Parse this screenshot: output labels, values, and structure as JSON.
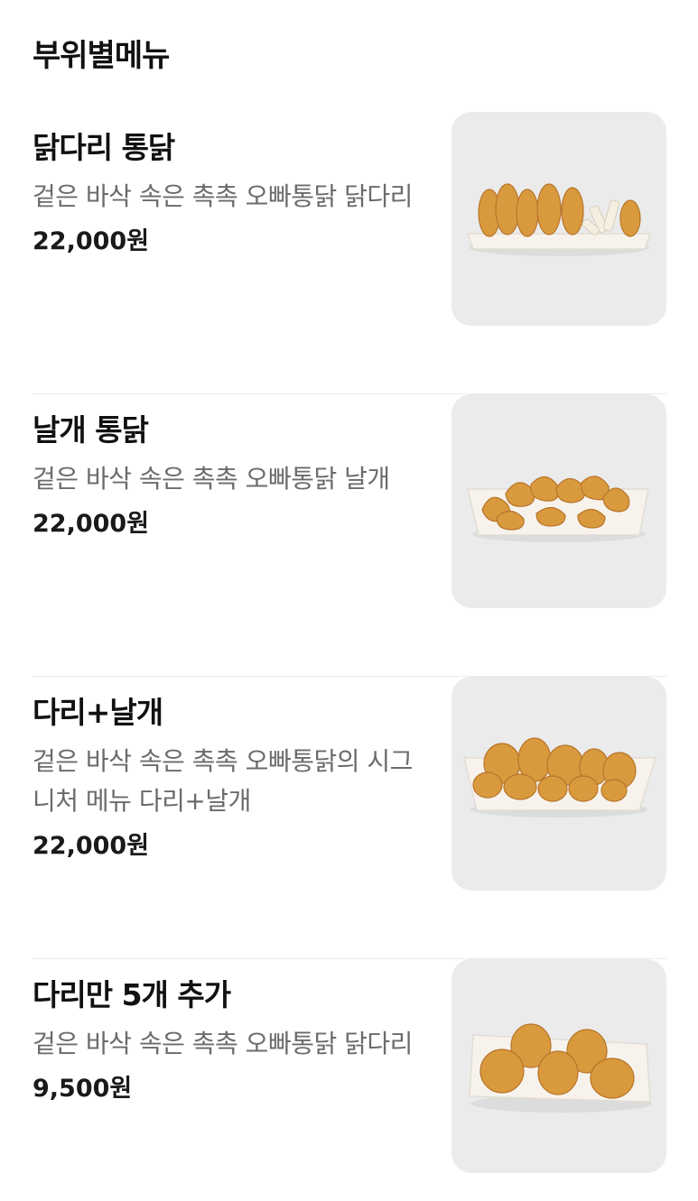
{
  "section": {
    "title": "부위별메뉴"
  },
  "menu": [
    {
      "name": "닭다리 통닭",
      "description": "겉은 바삭 속은 촉촉 오빠통닭 닭다리",
      "price": "22,000원",
      "image": "fried-drumsticks-tray-icon"
    },
    {
      "name": "날개 통닭",
      "description": "겉은 바삭 속은 촉촉 오빠통닭 날개",
      "price": "22,000원",
      "image": "fried-wings-tray-icon"
    },
    {
      "name": "다리+날개",
      "description": "겉은 바삭 속은 촉촉 오빠통닭의 시그니처 메뉴 다리+날개",
      "price": "22,000원",
      "image": "fried-legs-wings-tray-icon"
    },
    {
      "name": "다리만 5개 추가",
      "description": "겉은 바삭 속은 촉촉 오빠통닭 닭다리",
      "price": "9,500원",
      "image": "fried-drumsticks-plate-icon"
    }
  ],
  "colors": {
    "background": "#ffffff",
    "thumb_bg": "#ebebeb",
    "chicken": "#d99a3e",
    "chicken_dark": "#b8742a",
    "tray": "#f7f3ec"
  }
}
